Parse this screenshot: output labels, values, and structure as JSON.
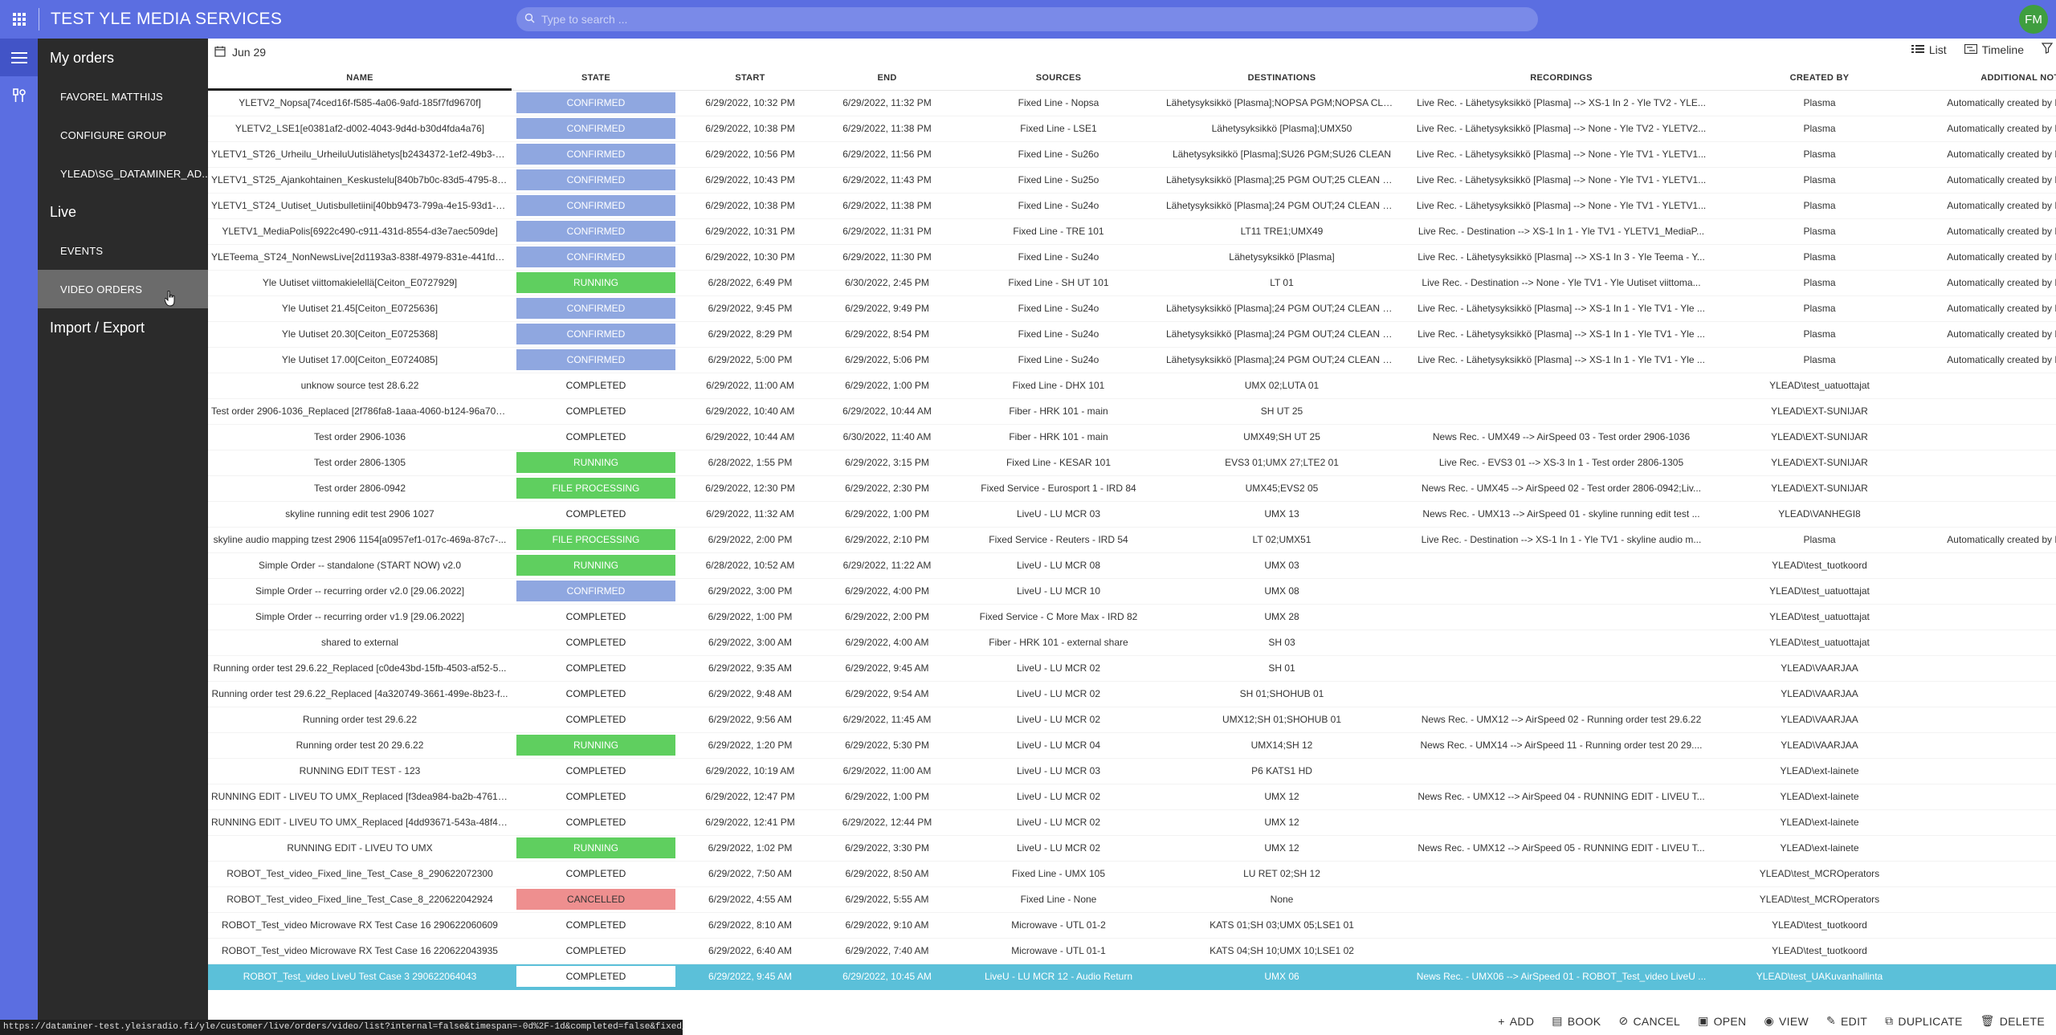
{
  "app": {
    "title": "TEST YLE MEDIA SERVICES",
    "avatar": "FM"
  },
  "search": {
    "placeholder": "Type to search ..."
  },
  "sidebar": {
    "my_orders": "My orders",
    "items": [
      "FAVOREL MATTHIJS",
      "CONFIGURE GROUP",
      "YLEAD\\SG_DATAMINER_AD..."
    ],
    "live": "Live",
    "live_items": [
      "EVENTS",
      "VIDEO ORDERS"
    ],
    "import_export": "Import / Export"
  },
  "toolbar": {
    "date": "Jun 29",
    "list": "List",
    "timeline": "Timeline"
  },
  "columns": [
    "NAME",
    "STATE",
    "START",
    "END",
    "SOURCES",
    "DESTINATIONS",
    "RECORDINGS",
    "CREATED BY",
    "ADDITIONAL NOTES"
  ],
  "rows": [
    [
      "YLETV2_Nopsa[74ced16f-f585-4a06-9afd-185f7fd9670f]",
      "CONFIRMED",
      "6/29/2022, 10:32 PM",
      "6/29/2022, 11:32 PM",
      "Fixed Line - Nopsa",
      "Lähetysyksikkö [Plasma];NOPSA PGM;NOPSA CLEAN",
      "Live Rec. - Lähetysyksikkö [Plasma] --> XS-1 In 2 - Yle TV2 - YLE...",
      "Plasma",
      "Automatically created by Plasma Inte"
    ],
    [
      "YLETV2_LSE1[e0381af2-d002-4043-9d4d-b30d4fda4a76]",
      "CONFIRMED",
      "6/29/2022, 10:38 PM",
      "6/29/2022, 11:38 PM",
      "Fixed Line - LSE1",
      "Lähetysyksikkö [Plasma];UMX50",
      "Live Rec. - Lähetysyksikkö [Plasma] --> None - Yle TV2 - YLETV2...",
      "Plasma",
      "Automatically created by Plasma Inte"
    ],
    [
      "YLETV1_ST26_Urheilu_UrheiluUutislähetys[b2434372-1ef2-49b3-b...",
      "CONFIRMED",
      "6/29/2022, 10:56 PM",
      "6/29/2022, 11:56 PM",
      "Fixed Line - Su26o",
      "Lähetysyksikkö [Plasma];SU26 PGM;SU26 CLEAN",
      "Live Rec. - Lähetysyksikkö [Plasma] --> None - Yle TV1 - YLETV1...",
      "Plasma",
      "Automatically created by Plasma Inte"
    ],
    [
      "YLETV1_ST25_Ajankohtainen_Keskustelu[840b7b0c-83d5-4795-87...",
      "CONFIRMED",
      "6/29/2022, 10:43 PM",
      "6/29/2022, 11:43 PM",
      "Fixed Line - Su25o",
      "Lähetysyksikkö [Plasma];25 PGM OUT;25 CLEAN OUT",
      "Live Rec. - Lähetysyksikkö [Plasma] --> None - Yle TV1 - YLETV1...",
      "Plasma",
      "Automatically created by Plasma Inte"
    ],
    [
      "YLETV1_ST24_Uutiset_Uutisbulletiini[40bb9473-799a-4e15-93d1-8...",
      "CONFIRMED",
      "6/29/2022, 10:38 PM",
      "6/29/2022, 11:38 PM",
      "Fixed Line - Su24o",
      "Lähetysyksikkö [Plasma];24 PGM OUT;24 CLEAN OUT",
      "Live Rec. - Lähetysyksikkö [Plasma] --> None - Yle TV1 - YLETV1...",
      "Plasma",
      "Automatically created by Plasma Inte"
    ],
    [
      "YLETV1_MediaPolis[6922c490-c911-431d-8554-d3e7aec509de]",
      "CONFIRMED",
      "6/29/2022, 10:31 PM",
      "6/29/2022, 11:31 PM",
      "Fixed Line - TRE 101",
      "LT11 TRE1;UMX49",
      "Live Rec. - Destination --> XS-1 In 1 - Yle TV1 - YLETV1_MediaP...",
      "Plasma",
      "Automatically created by Plasma Inte"
    ],
    [
      "YLETeema_ST24_NonNewsLive[2d1193a3-838f-4979-831e-441fd21...",
      "CONFIRMED",
      "6/29/2022, 10:30 PM",
      "6/29/2022, 11:30 PM",
      "Fixed Line - Su24o",
      "Lähetysyksikkö [Plasma]",
      "Live Rec. - Lähetysyksikkö [Plasma] --> XS-1 In 3 - Yle Teema - Y...",
      "Plasma",
      "Automatically created by Plasma Inte"
    ],
    [
      "Yle Uutiset viittomakielellä[Ceiton_E0727929]",
      "RUNNING",
      "6/28/2022, 6:49 PM",
      "6/30/2022, 2:45 PM",
      "Fixed Line - SH UT 101",
      "LT 01",
      "Live Rec. - Destination --> None - Yle TV1 - Yle Uutiset viittoma...",
      "Plasma",
      "Automatically created by Plasma Inte"
    ],
    [
      "Yle Uutiset 21.45[Ceiton_E0725636]",
      "CONFIRMED",
      "6/29/2022, 9:45 PM",
      "6/29/2022, 9:49 PM",
      "Fixed Line - Su24o",
      "Lähetysyksikkö [Plasma];24 PGM OUT;24 CLEAN OUT",
      "Live Rec. - Lähetysyksikkö [Plasma] --> XS-1 In 1 - Yle TV1 - Yle ...",
      "Plasma",
      "Automatically created by Plasma Inte"
    ],
    [
      "Yle Uutiset 20.30[Ceiton_E0725368]",
      "CONFIRMED",
      "6/29/2022, 8:29 PM",
      "6/29/2022, 8:54 PM",
      "Fixed Line - Su24o",
      "Lähetysyksikkö [Plasma];24 PGM OUT;24 CLEAN OUT",
      "Live Rec. - Lähetysyksikkö [Plasma] --> XS-1 In 1 - Yle TV1 - Yle ...",
      "Plasma",
      "Automatically created by Plasma Inte"
    ],
    [
      "Yle Uutiset 17.00[Ceiton_E0724085]",
      "CONFIRMED",
      "6/29/2022, 5:00 PM",
      "6/29/2022, 5:06 PM",
      "Fixed Line - Su24o",
      "Lähetysyksikkö [Plasma];24 PGM OUT;24 CLEAN OUT",
      "Live Rec. - Lähetysyksikkö [Plasma] --> XS-1 In 1 - Yle TV1 - Yle ...",
      "Plasma",
      "Automatically created by Plasma Inte"
    ],
    [
      "unknow source test 28.6.22",
      "COMPLETED",
      "6/29/2022, 11:00 AM",
      "6/29/2022, 1:00 PM",
      "Fixed Line - DHX 101",
      "UMX 02;LUTA 01",
      "",
      "YLEAD\\test_uatuottajat",
      ""
    ],
    [
      "Test order 2906-1036_Replaced [2f786fa8-1aaa-4060-b124-96a705...",
      "COMPLETED",
      "6/29/2022, 10:40 AM",
      "6/29/2022, 10:44 AM",
      "Fiber - HRK 101 - main",
      "SH UT 25",
      "",
      "YLEAD\\EXT-SUNIJAR",
      ""
    ],
    [
      "Test order 2906-1036",
      "COMPLETED",
      "6/29/2022, 10:44 AM",
      "6/30/2022, 11:40 AM",
      "Fiber - HRK 101 - main",
      "UMX49;SH UT 25",
      "News Rec. - UMX49 --> AirSpeed 03 - Test order 2906-1036",
      "YLEAD\\EXT-SUNIJAR",
      ""
    ],
    [
      "Test order 2806-1305",
      "RUNNING",
      "6/28/2022, 1:55 PM",
      "6/29/2022, 3:15 PM",
      "Fixed Line - KESAR 101",
      "EVS3 01;UMX 27;LTE2 01",
      "Live Rec. - EVS3 01 --> XS-3 In 1 - Test order 2806-1305",
      "YLEAD\\EXT-SUNIJAR",
      ""
    ],
    [
      "Test order 2806-0942",
      "FILE PROCESSING",
      "6/29/2022, 12:30 PM",
      "6/29/2022, 2:30 PM",
      "Fixed Service - Eurosport 1 - IRD 84",
      "UMX45;EVS2 05",
      "News Rec. - UMX45 --> AirSpeed 02 - Test order 2806-0942;Liv...",
      "YLEAD\\EXT-SUNIJAR",
      ""
    ],
    [
      "skyline running edit test 2906 1027",
      "COMPLETED",
      "6/29/2022, 11:32 AM",
      "6/29/2022, 1:00 PM",
      "LiveU - LU MCR 03",
      "UMX 13",
      "News Rec. - UMX13 --> AirSpeed 01 - skyline running edit test ...",
      "YLEAD\\VANHEGI8",
      ""
    ],
    [
      "skyline audio mapping tzest 2906 1154[a0957ef1-017c-469a-87c7-...",
      "FILE PROCESSING",
      "6/29/2022, 2:00 PM",
      "6/29/2022, 2:10 PM",
      "Fixed Service - Reuters - IRD 54",
      "LT 02;UMX51",
      "Live Rec. - Destination --> XS-1 In 1 - Yle TV1 - skyline audio m...",
      "Plasma",
      "Automatically created by Plasma Inte"
    ],
    [
      "Simple Order -- standalone (START NOW) v2.0",
      "RUNNING",
      "6/28/2022, 10:52 AM",
      "6/29/2022, 11:22 AM",
      "LiveU - LU MCR 08",
      "UMX 03",
      "",
      "YLEAD\\test_tuotkoord",
      ""
    ],
    [
      "Simple Order -- recurring order v2.0 [29.06.2022]",
      "CONFIRMED",
      "6/29/2022, 3:00 PM",
      "6/29/2022, 4:00 PM",
      "LiveU - LU MCR 10",
      "UMX 08",
      "",
      "YLEAD\\test_uatuottajat",
      ""
    ],
    [
      "Simple Order -- recurring order v1.9 [29.06.2022]",
      "COMPLETED",
      "6/29/2022, 1:00 PM",
      "6/29/2022, 2:00 PM",
      "Fixed Service - C More Max - IRD 82",
      "UMX 28",
      "",
      "YLEAD\\test_uatuottajat",
      ""
    ],
    [
      "shared to external",
      "COMPLETED",
      "6/29/2022, 3:00 AM",
      "6/29/2022, 4:00 AM",
      "Fiber - HRK 101 - external share",
      "SH 03",
      "",
      "YLEAD\\test_uatuottajat",
      ""
    ],
    [
      "Running order test 29.6.22_Replaced [c0de43bd-15fb-4503-af52-5...",
      "COMPLETED",
      "6/29/2022, 9:35 AM",
      "6/29/2022, 9:45 AM",
      "LiveU - LU MCR 02",
      "SH 01",
      "",
      "YLEAD\\VAARJAA",
      ""
    ],
    [
      "Running order test 29.6.22_Replaced [4a320749-3661-499e-8b23-f...",
      "COMPLETED",
      "6/29/2022, 9:48 AM",
      "6/29/2022, 9:54 AM",
      "LiveU - LU MCR 02",
      "SH 01;SHOHUB 01",
      "",
      "YLEAD\\VAARJAA",
      ""
    ],
    [
      "Running order test 29.6.22",
      "COMPLETED",
      "6/29/2022, 9:56 AM",
      "6/29/2022, 11:45 AM",
      "LiveU - LU MCR 02",
      "UMX12;SH 01;SHOHUB 01",
      "News Rec. - UMX12 --> AirSpeed 02 - Running order test 29.6.22",
      "YLEAD\\VAARJAA",
      ""
    ],
    [
      "Running order test 20 29.6.22",
      "RUNNING",
      "6/29/2022, 1:20 PM",
      "6/29/2022, 5:30 PM",
      "LiveU - LU MCR 04",
      "UMX14;SH 12",
      "News Rec. - UMX14 --> AirSpeed 11 - Running order test 20 29....",
      "YLEAD\\VAARJAA",
      ""
    ],
    [
      "RUNNING EDIT TEST - 123",
      "COMPLETED",
      "6/29/2022, 10:19 AM",
      "6/29/2022, 11:00 AM",
      "LiveU - LU MCR 03",
      "P6 KATS1 HD",
      "",
      "YLEAD\\ext-lainete",
      ""
    ],
    [
      "RUNNING EDIT - LIVEU TO UMX_Replaced [f3dea984-ba2b-4761-9...",
      "COMPLETED",
      "6/29/2022, 12:47 PM",
      "6/29/2022, 1:00 PM",
      "LiveU - LU MCR 02",
      "UMX 12",
      "News Rec. - UMX12 --> AirSpeed 04 - RUNNING EDIT - LIVEU T...",
      "YLEAD\\ext-lainete",
      ""
    ],
    [
      "RUNNING EDIT - LIVEU TO UMX_Replaced [4dd93671-543a-48f4-a...",
      "COMPLETED",
      "6/29/2022, 12:41 PM",
      "6/29/2022, 12:44 PM",
      "LiveU - LU MCR 02",
      "UMX 12",
      "",
      "YLEAD\\ext-lainete",
      ""
    ],
    [
      "RUNNING EDIT - LIVEU TO UMX",
      "RUNNING",
      "6/29/2022, 1:02 PM",
      "6/29/2022, 3:30 PM",
      "LiveU - LU MCR 02",
      "UMX 12",
      "News Rec. - UMX12 --> AirSpeed 05 - RUNNING EDIT - LIVEU T...",
      "YLEAD\\ext-lainete",
      ""
    ],
    [
      "ROBOT_Test_video_Fixed_line_Test_Case_8_290622072300",
      "COMPLETED",
      "6/29/2022, 7:50 AM",
      "6/29/2022, 8:50 AM",
      "Fixed Line - UMX 105",
      "LU RET 02;SH 12",
      "",
      "YLEAD\\test_MCROperators",
      ""
    ],
    [
      "ROBOT_Test_video_Fixed_line_Test_Case_8_220622042924",
      "CANCELLED",
      "6/29/2022, 4:55 AM",
      "6/29/2022, 5:55 AM",
      "Fixed Line - None",
      "None",
      "",
      "YLEAD\\test_MCROperators",
      ""
    ],
    [
      "ROBOT_Test_video Microwave RX Test Case 16 290622060609",
      "COMPLETED",
      "6/29/2022, 8:10 AM",
      "6/29/2022, 9:10 AM",
      "Microwave - UTL 01-2",
      "KATS 01;SH 03;UMX 05;LSE1 01",
      "",
      "YLEAD\\test_tuotkoord",
      ""
    ],
    [
      "ROBOT_Test_video Microwave RX Test Case 16 220622043935",
      "COMPLETED",
      "6/29/2022, 6:40 AM",
      "6/29/2022, 7:40 AM",
      "Microwave - UTL 01-1",
      "KATS 04;SH 10;UMX 10;LSE1 02",
      "",
      "YLEAD\\test_tuotkoord",
      ""
    ],
    [
      "ROBOT_Test_video LiveU Test Case 3 290622064043",
      "COMPLETED",
      "6/29/2022, 9:45 AM",
      "6/29/2022, 10:45 AM",
      "LiveU - LU MCR 12 - Audio Return",
      "UMX 06",
      "News Rec. - UMX06 --> AirSpeed 01 - ROBOT_Test_video LiveU ...",
      "YLEAD\\test_UAKuvanhallinta",
      ""
    ]
  ],
  "actions": [
    "ADD",
    "BOOK",
    "CANCEL",
    "OPEN",
    "VIEW",
    "EDIT",
    "DUPLICATE",
    "DELETE"
  ],
  "status_url": "https://dataminer-test.yleisradio.fi/yle/customer/live/orders/video/list?internal=false&timespan=-0d%2F-1d&completed=false&fixed_source_plasma=false...",
  "colors": {
    "accent": "#5b6ee1",
    "confirmed": "#8fa7e0",
    "running": "#5fcf5f",
    "cancelled": "#ee8f8f",
    "selected_row": "#5bc0d9"
  }
}
